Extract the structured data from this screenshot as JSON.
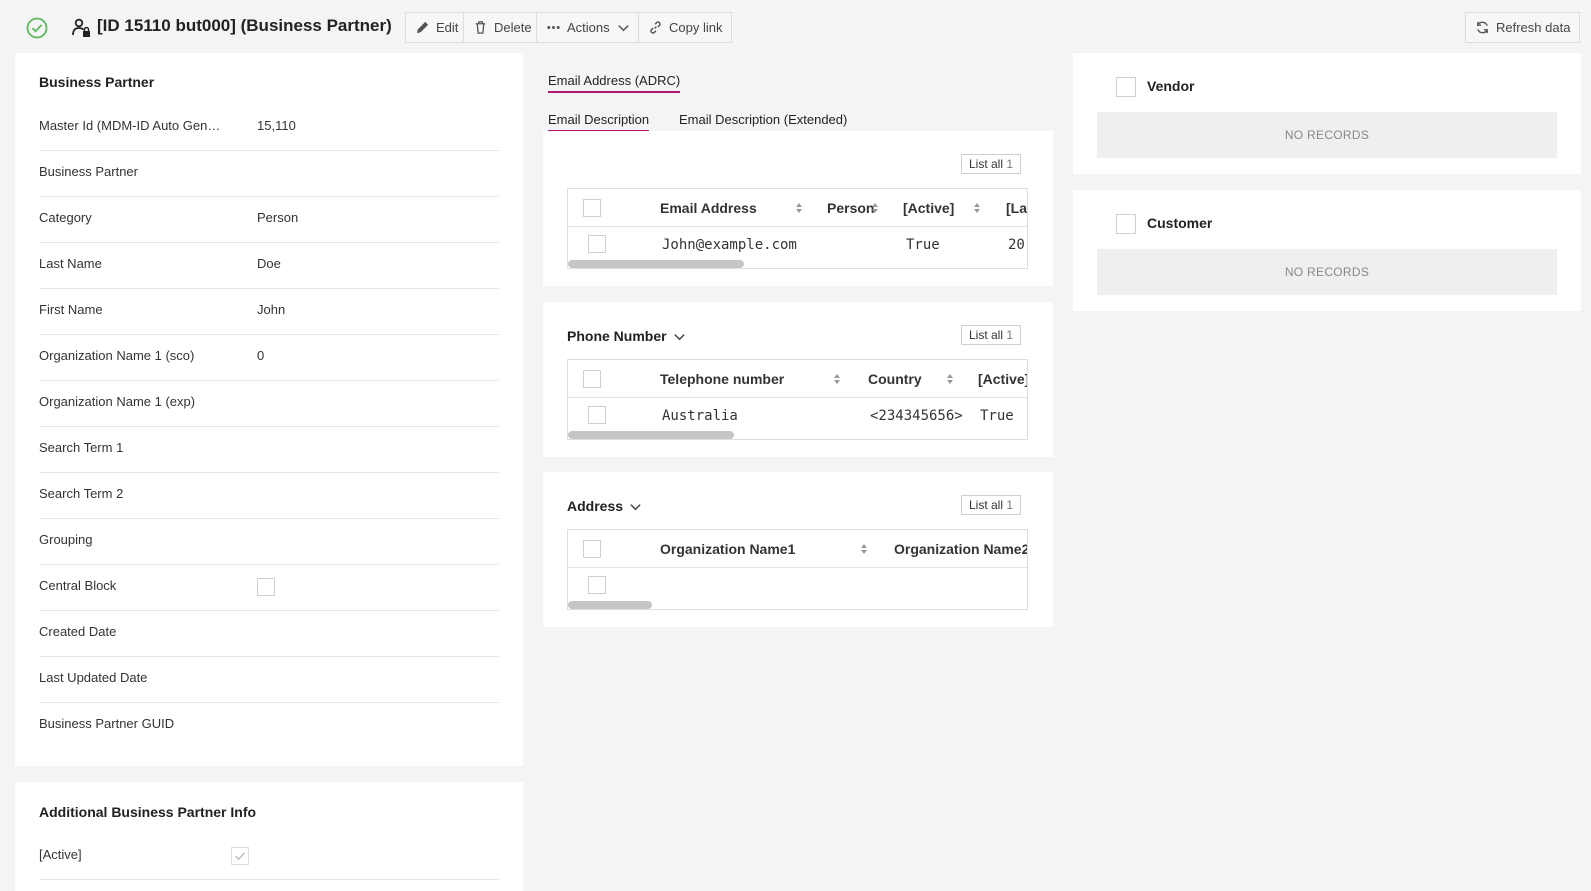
{
  "header": {
    "title": "[ID 15110 but000]  (Business Partner)",
    "edit_label": "Edit",
    "delete_label": "Delete",
    "actions_label": "Actions",
    "copy_link_label": "Copy link",
    "refresh_label": "Refresh data"
  },
  "business_partner": {
    "title": "Business Partner",
    "fields": [
      {
        "label": "Master Id (MDM-ID Auto Gene...",
        "value": "15,110"
      },
      {
        "label": "Business Partner",
        "value": ""
      },
      {
        "label": "Category",
        "value": "Person"
      },
      {
        "label": "Last Name",
        "value": "Doe"
      },
      {
        "label": "First Name",
        "value": "John"
      },
      {
        "label": "Organization Name 1 (sco)",
        "value": "0"
      },
      {
        "label": "Organization Name 1 (exp)",
        "value": ""
      },
      {
        "label": "Search Term 1",
        "value": ""
      },
      {
        "label": "Search Term 2",
        "value": ""
      },
      {
        "label": "Grouping",
        "value": ""
      },
      {
        "label": "Central Block",
        "value": ""
      },
      {
        "label": "Created Date",
        "value": ""
      },
      {
        "label": "Last Updated Date",
        "value": ""
      },
      {
        "label": "Business Partner GUID",
        "value": ""
      }
    ]
  },
  "additional_info": {
    "title": "Additional Business Partner Info",
    "active_label": "[Active]"
  },
  "email": {
    "top_tab": "Email Address (ADRC)",
    "tabs": [
      "Email Description",
      "Email Description (Extended)"
    ],
    "list_all": "List all",
    "count": "1",
    "columns": [
      "Email Address",
      "Person",
      "[Active]",
      "[La"
    ],
    "row": {
      "email": "John@example.com",
      "person": "",
      "active": "True",
      "last": "20"
    }
  },
  "phone": {
    "title": "Phone Number",
    "list_all": "List all",
    "count": "1",
    "columns": [
      "Telephone number",
      "Country",
      "[Active]"
    ],
    "row": {
      "telephone": "Australia",
      "country": "<234345656>",
      "active": "True"
    }
  },
  "address": {
    "title": "Address",
    "list_all": "List all",
    "count": "1",
    "columns": [
      "Organization Name1",
      "Organization Name2"
    ]
  },
  "vendor": {
    "title": "Vendor",
    "empty": "NO RECORDS"
  },
  "customer": {
    "title": "Customer",
    "empty": "NO RECORDS"
  },
  "colors": {
    "accent": "#b3166f",
    "status_ok": "#4caf50"
  }
}
